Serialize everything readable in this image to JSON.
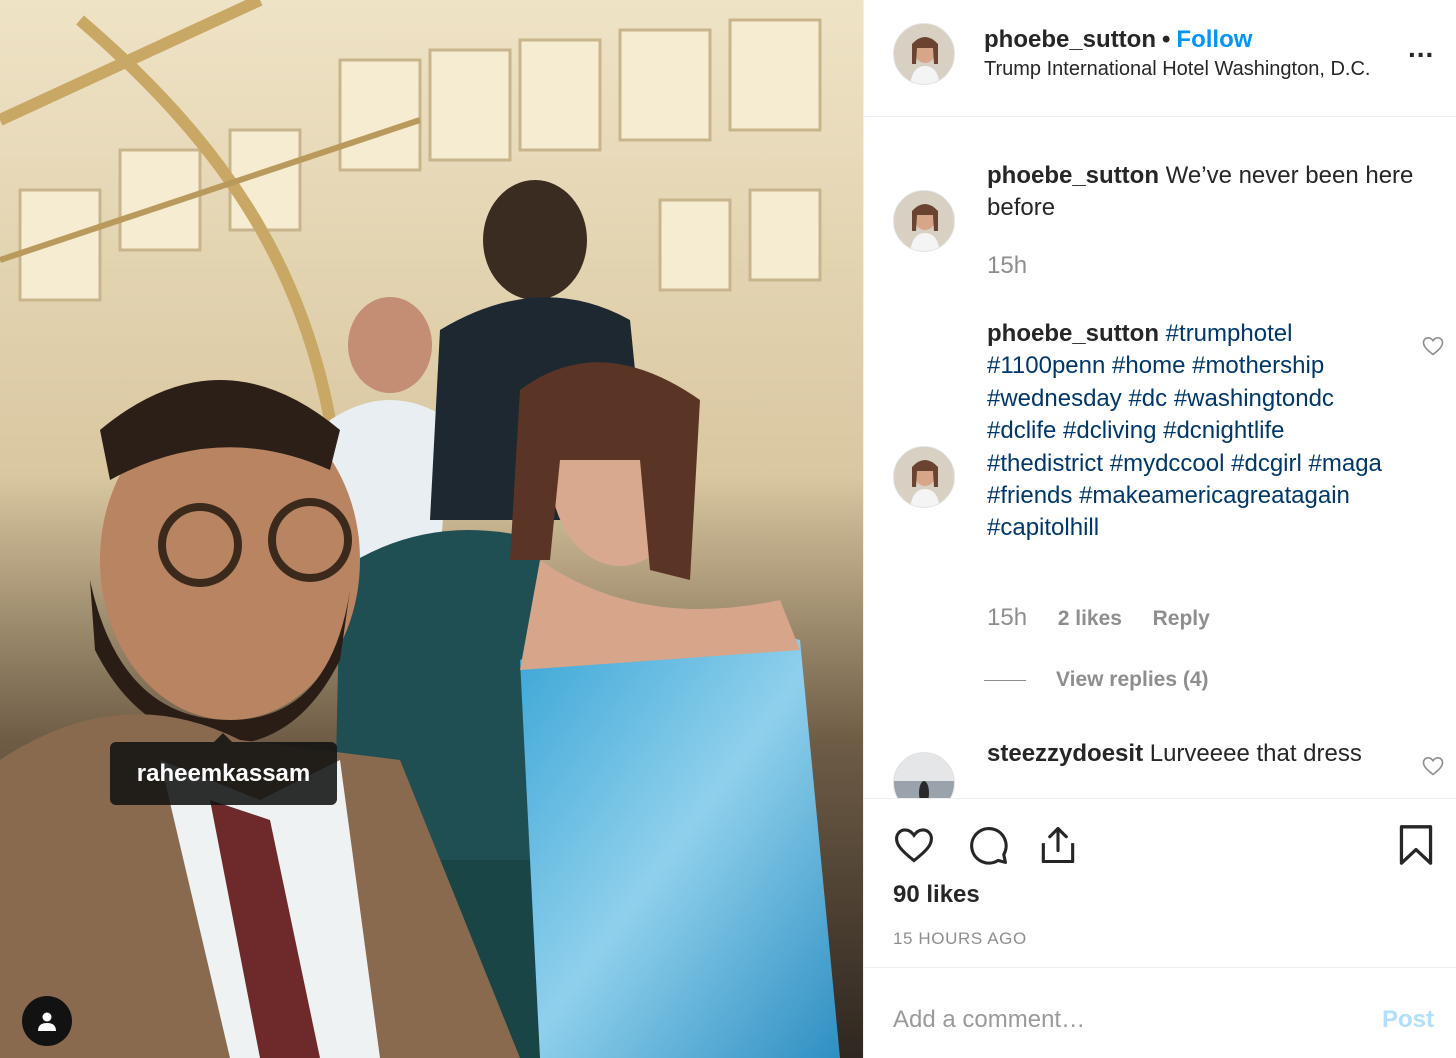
{
  "photo": {
    "tag_label": "raheemkassam",
    "user_tag_icon": "person-icon"
  },
  "header": {
    "username": "phoebe_sutton",
    "separator": "•",
    "follow_label": "Follow",
    "location": "Trump International Hotel Washington, D.C.",
    "more_icon": "more-options-icon",
    "more_label": "..."
  },
  "comments": [
    {
      "username": "phoebe_sutton",
      "text": "We’ve never been here before",
      "time": "15h"
    },
    {
      "username": "phoebe_sutton",
      "hashtags": [
        "#trumphotel",
        "#1100penn",
        "#home",
        "#mothership",
        "#wednesday",
        "#dc",
        "#washingtondc",
        "#dclife",
        "#dcliving",
        "#dcnightlife",
        "#thedistrict",
        "#mydccool",
        "#dcgirl",
        "#maga",
        "#friends",
        "#makeamericagreatagain",
        "#capitolhill"
      ],
      "time": "15h",
      "likes": "2 likes",
      "reply_label": "Reply",
      "view_replies": "View replies (4)"
    },
    {
      "username": "steezzydoesit",
      "text": "Lurveeee that dress"
    }
  ],
  "actions": {
    "like_icon": "heart-icon",
    "comment_icon": "comment-icon",
    "share_icon": "share-icon",
    "save_icon": "bookmark-icon",
    "likes": "90 likes",
    "time_ago": "15 HOURS AGO"
  },
  "add_comment": {
    "placeholder": "Add a comment…",
    "post_label": "Post"
  },
  "colors": {
    "follow": "#0095f6",
    "hashtag": "#00376b",
    "muted": "#8e8e8e",
    "post_disabled": "#b2dffc"
  }
}
